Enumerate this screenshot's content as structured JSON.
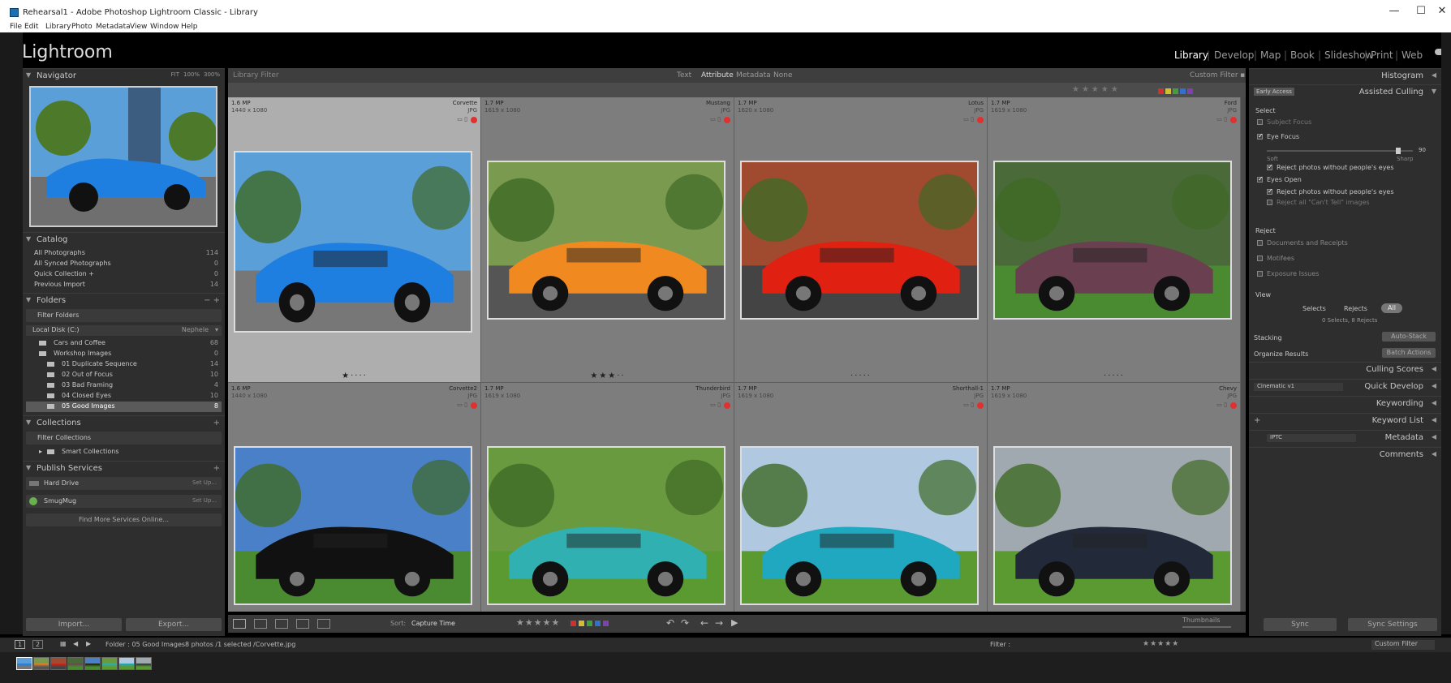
{
  "window": {
    "title": "Rehearsal1 - Adobe Photoshop Lightroom Classic - Library",
    "minimize": "—",
    "maximize": "☐",
    "close": "✕"
  },
  "menu": [
    "File",
    "Edit",
    "Library",
    "Photo",
    "Metadata",
    "View",
    "Window",
    "Help"
  ],
  "app": {
    "logo": "Lightroom"
  },
  "modules": [
    "Library",
    "Develop",
    "Map",
    "Book",
    "Slideshow",
    "Print",
    "Web"
  ],
  "modules_sep": "|",
  "navigator": {
    "title": "Navigator",
    "zoom": [
      "FIT",
      "100%",
      "300%"
    ]
  },
  "catalog": {
    "title": "Catalog",
    "items": [
      {
        "label": "All Photographs",
        "count": "114"
      },
      {
        "label": "All Synced Photographs",
        "count": "0"
      },
      {
        "label": "Quick Collection +",
        "count": "0"
      },
      {
        "label": "Previous Import",
        "count": "14"
      }
    ]
  },
  "folders": {
    "title": "Folders",
    "filter": "Filter Folders",
    "disk": "Local Disk (C:)",
    "disk_space": "Nephele",
    "items": [
      {
        "label": "Cars and Coffee",
        "count": "68"
      },
      {
        "label": "Workshop Images",
        "count": "0"
      },
      {
        "label": "01 Duplicate Sequence",
        "count": "14"
      },
      {
        "label": "02 Out of Focus",
        "count": "10"
      },
      {
        "label": "03 Bad Framing",
        "count": "4"
      },
      {
        "label": "04 Closed Eyes",
        "count": "10"
      },
      {
        "label": "05 Good Images",
        "count": "8"
      }
    ]
  },
  "collections": {
    "title": "Collections",
    "filter": "Filter Collections",
    "smart": "Smart Collections"
  },
  "publish": {
    "title": "Publish Services",
    "items": [
      {
        "label": "Hard Drive",
        "action": "Set Up..."
      },
      {
        "label": "SmugMug",
        "action": "Set Up..."
      }
    ],
    "find_more": "Find More Services Online..."
  },
  "buttons": {
    "import": "Import...",
    "export": "Export..."
  },
  "library_filter": {
    "label": "Library Filter",
    "tabs": [
      "Text",
      "Attribute",
      "Metadata",
      "None"
    ],
    "preset": "Custom Filter"
  },
  "grid": [
    {
      "mp": "1.6 MP",
      "dims": "1440 x 1080",
      "name": "Corvette",
      "format": "JPG",
      "rating": 1,
      "selected": true,
      "colors": {
        "sky": "#5a9fd8",
        "body": "#1e7fe0",
        "ground": "#777"
      }
    },
    {
      "mp": "1.7 MP",
      "dims": "1619 x 1080",
      "name": "Mustang",
      "format": "JPG",
      "rating": 3,
      "selected": false,
      "colors": {
        "sky": "#7a9a50",
        "body": "#f08a20",
        "ground": "#555"
      }
    },
    {
      "mp": "1.7 MP",
      "dims": "1620 x 1080",
      "name": "Lotus",
      "format": "JPG",
      "rating": 0,
      "selected": false,
      "colors": {
        "sky": "#a04a30",
        "body": "#e02010",
        "ground": "#444"
      }
    },
    {
      "mp": "1.7 MP",
      "dims": "1619 x 1080",
      "name": "Ford",
      "format": "JPG",
      "rating": 0,
      "selected": false,
      "colors": {
        "sky": "#4a6a3a",
        "body": "#6a4050",
        "ground": "#4a8a30"
      }
    },
    {
      "mp": "1.6 MP",
      "dims": "1440 x 1080",
      "name": "Corvette2",
      "format": "JPG",
      "rating": 0,
      "selected": false,
      "colors": {
        "sky": "#4a80c8",
        "body": "#111",
        "ground": "#4a8a30"
      }
    },
    {
      "mp": "1.7 MP",
      "dims": "1619 x 1080",
      "name": "Thunderbird",
      "format": "JPG",
      "rating": 0,
      "selected": false,
      "colors": {
        "sky": "#6a9a40",
        "body": "#30b0b0",
        "ground": "#5a9a30"
      }
    },
    {
      "mp": "1.7 MP",
      "dims": "1619 x 1080",
      "name": "Shorthall-1",
      "format": "JPG",
      "rating": 0,
      "selected": false,
      "colors": {
        "sky": "#b0c8e0",
        "body": "#20a8c0",
        "ground": "#5a9a30"
      }
    },
    {
      "mp": "1.7 MP",
      "dims": "1619 x 1080",
      "name": "Chevy",
      "format": "JPG",
      "rating": 0,
      "selected": false,
      "colors": {
        "sky": "#a0a8b0",
        "body": "#222a3a",
        "ground": "#5a9a30"
      }
    }
  ],
  "right": {
    "histogram": "Histogram",
    "early_access": "Early Access",
    "assisted_culling": "Assisted Culling",
    "select_label": "Select",
    "subject_focus": "Subject Focus",
    "eye_focus": "Eye Focus",
    "soft": "Soft",
    "sharp": "Sharp",
    "slider_value": "90",
    "eye_focus_slider": 0.9,
    "reject_eyes_1": "Reject photos without people's eyes",
    "eyes_open": "Eyes Open",
    "reject_eyes_2": "Reject photos without people's eyes",
    "reject_cant_tell": "Reject all \"Can't Tell\" images",
    "reject_label": "Reject",
    "documents": "Documents and Receipts",
    "motives": "Motifees",
    "exposure": "Exposure Issues",
    "view_label": "View",
    "view_tabs": [
      "Selects",
      "Rejects",
      "All"
    ],
    "summary": "0 Selects, 8 Rejects",
    "stacking": "Stacking",
    "auto_stack": "Auto-Stack",
    "organize": "Organize Results",
    "batch_actions": "Batch Actions",
    "culling_scores": "Culling Scores",
    "quick_develop": "Quick Develop",
    "quick_develop_preset": "Cinematic v1",
    "keywording": "Keywording",
    "keyword_list": "Keyword List",
    "metadata": "Metadata",
    "metadata_preset": "IPTC",
    "comments": "Comments"
  },
  "toolbar": {
    "sort_label": "Sort:",
    "sort_value": "Capture Time",
    "thumbnails_label": "Thumbnails"
  },
  "sync": {
    "sync": "Sync",
    "sync_settings": "Sync Settings"
  },
  "status": {
    "pages": [
      "1",
      "2"
    ],
    "folder": "Folder : 05 Good Images",
    "count": "8 photos /1 selected /Corvette.jpg",
    "filter_label": "Filter :",
    "filter_value": "Custom Filter"
  },
  "color_labels": [
    "#d03030",
    "#d0c030",
    "#40a040",
    "#3070d0",
    "#8040b0"
  ]
}
